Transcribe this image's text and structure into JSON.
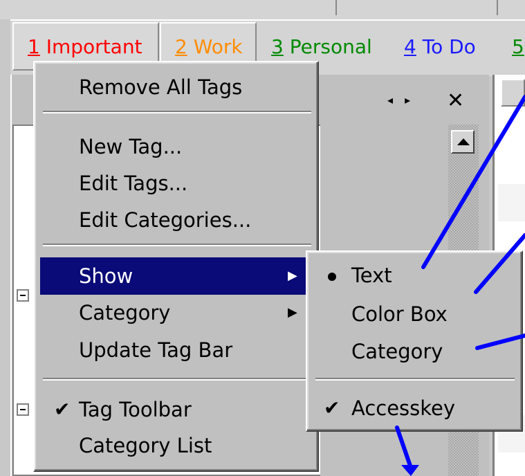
{
  "tag_bar": {
    "tags": [
      {
        "key": "1",
        "label": " Important",
        "color": "#ff0000"
      },
      {
        "key": "2",
        "label": " Work",
        "color": "#ff8c00"
      },
      {
        "key": "3",
        "label": " Personal",
        "color": "#008a00"
      },
      {
        "key": "4",
        "label": " To Do",
        "color": "#1a1aff"
      },
      {
        "key": "5",
        "label": "",
        "color": "#008a00"
      }
    ]
  },
  "panel": {
    "nav_arrows": "◂ ▸",
    "close_glyph": "✕"
  },
  "context_menu": {
    "items": {
      "remove_all": "Remove All Tags",
      "new_tag": "New Tag...",
      "edit_tags": "Edit Tags...",
      "edit_categories": "Edit Categories...",
      "show": "Show",
      "category": "Category",
      "update_tag_bar": "Update Tag Bar",
      "tag_toolbar": "Tag Toolbar",
      "category_list": "Category List"
    },
    "checked": [
      "tag_toolbar"
    ],
    "highlighted": "show"
  },
  "show_submenu": {
    "items": {
      "text": "Text",
      "color_box": "Color Box",
      "category": "Category",
      "accesskey": "Accesskey"
    },
    "selected": "text",
    "checked": [
      "accesskey"
    ]
  },
  "colors": {
    "highlight": "#0a0a78",
    "annotation": "#0000ff"
  },
  "icons": {
    "check": "✔",
    "submenu_arrow": "▶"
  }
}
